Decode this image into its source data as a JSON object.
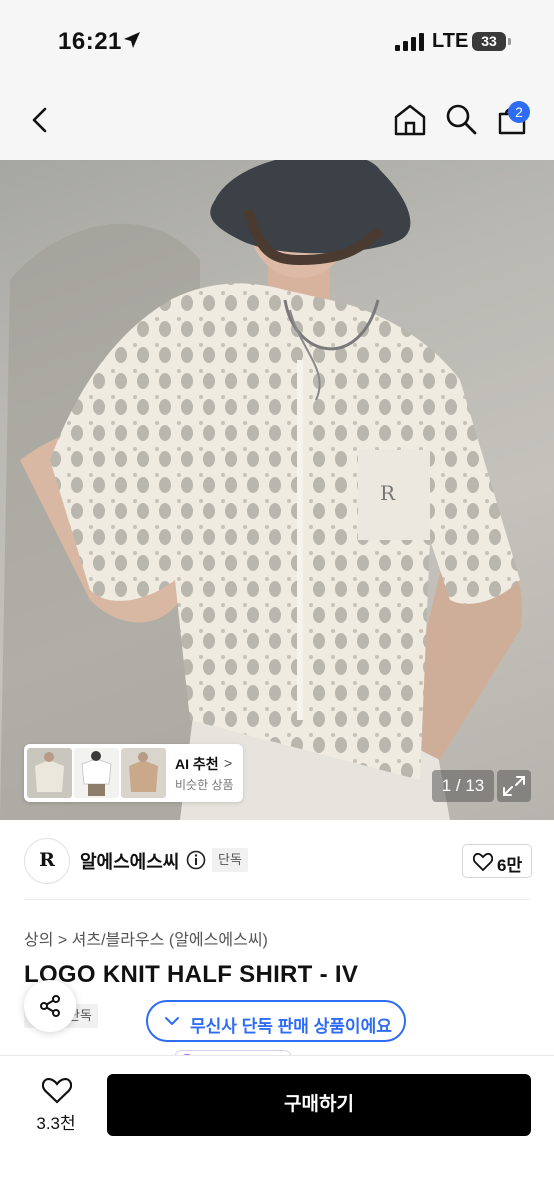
{
  "status_bar": {
    "time": "16:21",
    "network": "LTE",
    "battery": "33"
  },
  "header": {
    "cart_count": "2"
  },
  "gallery": {
    "counter": "1 / 13",
    "ai": {
      "title": "AI 추천",
      "subtitle": "비슷한 상품"
    }
  },
  "brand": {
    "logo_text": "R",
    "name": "알에스에스씨",
    "tag": "단독",
    "likes": "6만"
  },
  "product": {
    "breadcrumb": "상의 > 셔츠/블라우스 (알에스에스씨)",
    "title": "LOGO KNIT HALF SHIRT - IV",
    "tag": "단독",
    "exclusive_notice": "무신사 단독 판매 상품이에요"
  },
  "bottom": {
    "wishlist_count": "3.3천",
    "buy_label": "구매하기"
  },
  "colors": {
    "accent": "#2f6cf6",
    "buy_button": "#000000"
  }
}
